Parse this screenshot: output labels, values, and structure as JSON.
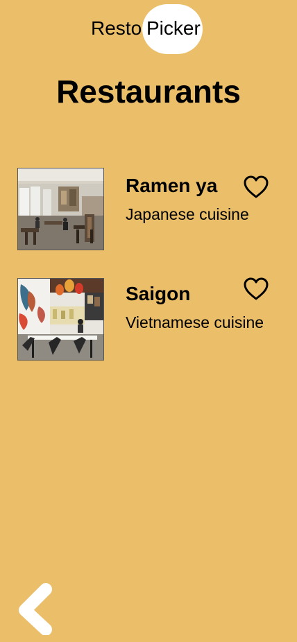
{
  "header": {
    "logo_left": "Resto",
    "logo_right": "Picker"
  },
  "page": {
    "title": "Restaurants"
  },
  "restaurants": [
    {
      "name": "Ramen ya",
      "cuisine": "Japanese cuisine",
      "favorite": false
    },
    {
      "name": "Saigon",
      "cuisine": "Vietnamese cuisine",
      "favorite": false
    }
  ],
  "icons": {
    "favorite": "heart-outline-icon",
    "back": "chevron-left-icon"
  },
  "colors": {
    "background": "#EBBE69",
    "logo_pill": "#FFFFFF",
    "text": "#000000",
    "back_icon": "#FFFFFF"
  }
}
